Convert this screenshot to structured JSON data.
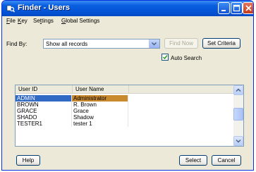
{
  "window": {
    "title": "Finder - Users"
  },
  "menu": [
    {
      "label": "File",
      "accel": "F",
      "rest": "ile"
    },
    {
      "label": "Key",
      "accel": "K",
      "rest": "ey"
    },
    {
      "label": "Settings",
      "accel": "",
      "pre": "Se",
      "accel2": "t",
      "rest": "tings"
    },
    {
      "label": "Global Settings",
      "accel": "G",
      "rest": "lobal Settings"
    }
  ],
  "find": {
    "label": "Find By:",
    "selected": "Show all records",
    "find_now_label": "Find Now",
    "set_criteria_label": "Set Criteria",
    "auto_search_label": "Auto Search",
    "auto_search_checked": true
  },
  "table": {
    "columns": [
      "User ID",
      "User Name"
    ],
    "rows": [
      {
        "id": "ADMIN",
        "name": "Administrator",
        "selected": true
      },
      {
        "id": "BROWN",
        "name": "R. Brown",
        "selected": false
      },
      {
        "id": "GRACE",
        "name": "Grace",
        "selected": false
      },
      {
        "id": "SHADO",
        "name": "Shadow",
        "selected": false
      },
      {
        "id": "TESTER1",
        "name": "tester 1",
        "selected": false
      }
    ]
  },
  "buttons": {
    "help": "Help",
    "select": "Select",
    "cancel": "Cancel"
  },
  "colors": {
    "titlebar": "#0454d6",
    "selection_id": "#316ac5",
    "selection_name": "#c98a2e",
    "dialog_bg": "#ece9d8"
  }
}
